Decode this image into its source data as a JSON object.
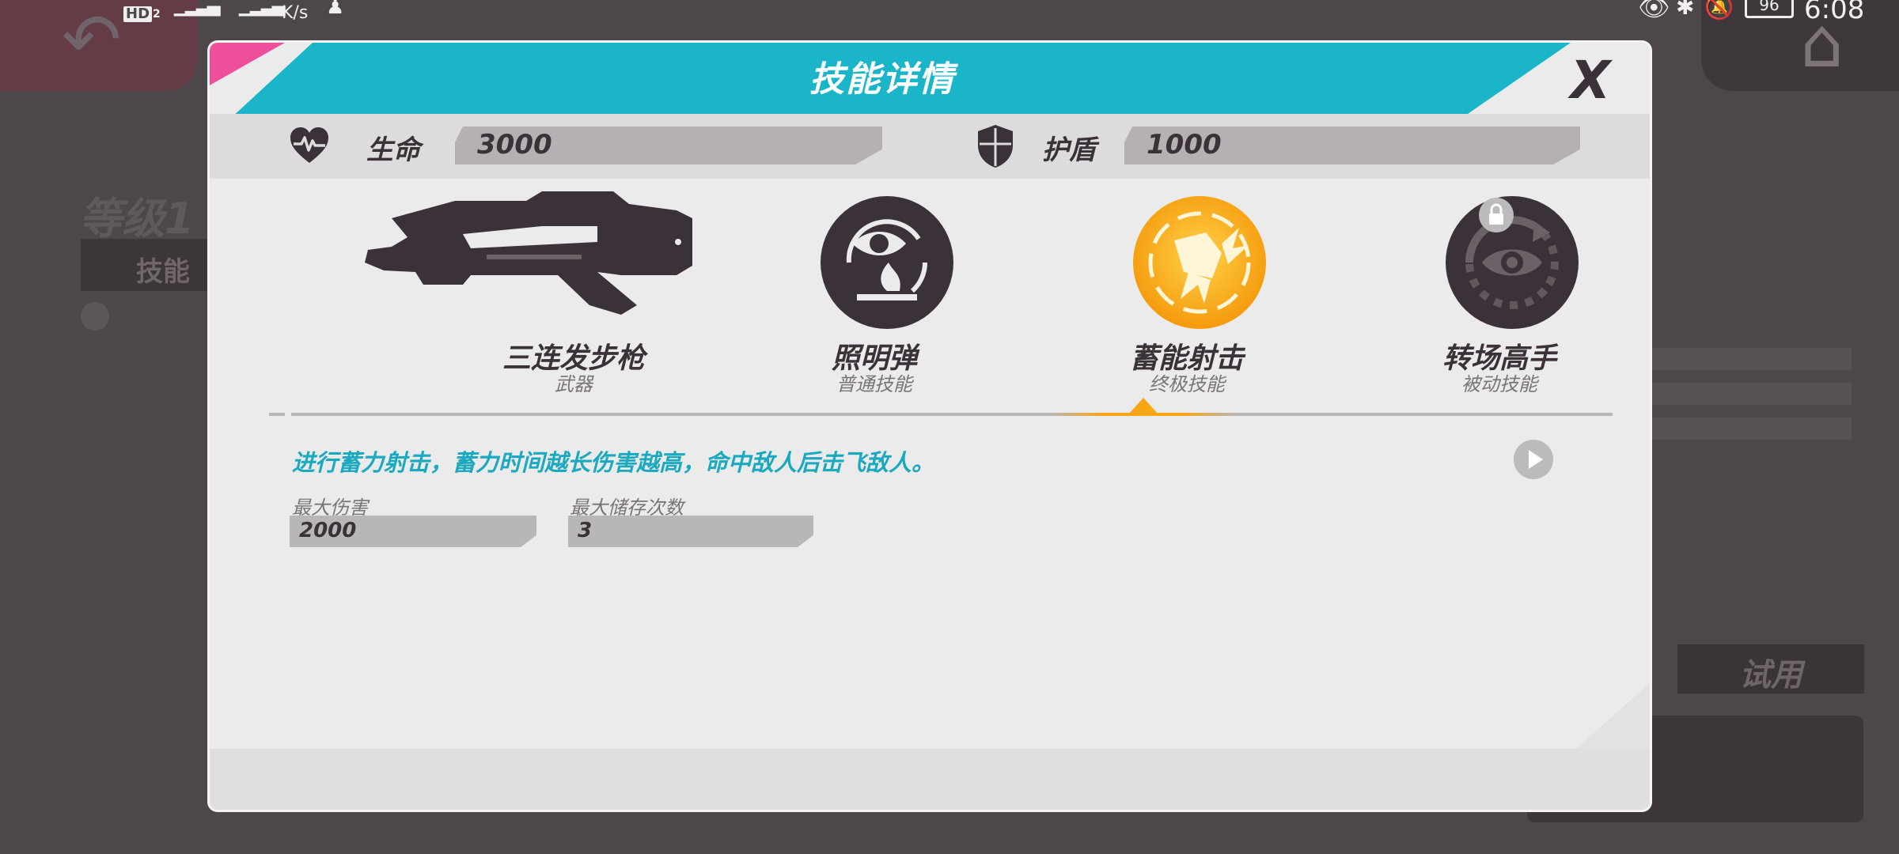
{
  "status_bar": {
    "hd": "HD",
    "sim": "2",
    "speed": "K/s",
    "battery": "96",
    "time": "6:08"
  },
  "background": {
    "level": "等级1",
    "skill_tab": "技能",
    "try_button": "试用"
  },
  "dialog": {
    "title": "技能详情",
    "close_label": "X",
    "stats": {
      "hp_label": "生命",
      "hp_value": "3000",
      "shield_label": "护盾",
      "shield_value": "1000"
    },
    "skills": [
      {
        "name": "三连发步枪",
        "type": "武器",
        "icon": "rifle-icon",
        "selected": false
      },
      {
        "name": "照明弹",
        "type": "普通技能",
        "icon": "flare-icon",
        "selected": false
      },
      {
        "name": "蓄能射击",
        "type": "终极技能",
        "icon": "charged-shot-icon",
        "selected": true
      },
      {
        "name": "转场高手",
        "type": "被动技能",
        "icon": "eye-icon",
        "selected": false,
        "locked": true
      }
    ],
    "description": "进行蓄力射击，蓄力时间越长伤害越高，命中敌人后击飞敌人。",
    "attributes": [
      {
        "label": "最大伤害",
        "value": "2000"
      },
      {
        "label": "最大储存次数",
        "value": "3"
      }
    ]
  },
  "colors": {
    "teal": "#1bb5c9",
    "pink": "#ef4f9a",
    "orange": "#f7a614",
    "dark": "#3a3238"
  }
}
